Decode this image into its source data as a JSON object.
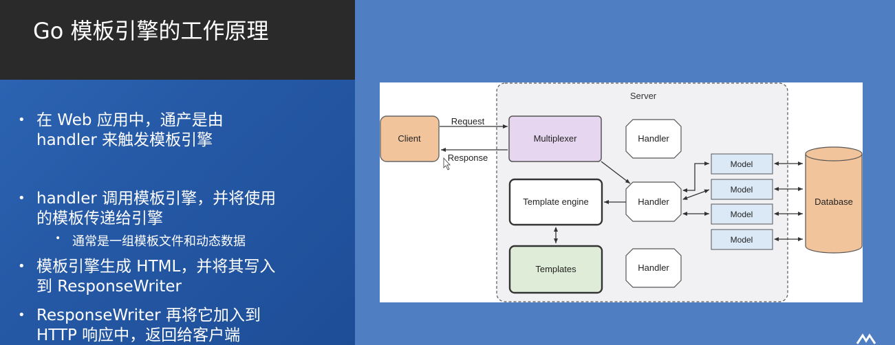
{
  "slide": {
    "title": "Go 模板引擎的工作原理",
    "bullets": [
      {
        "lines": [
          "在 Web 应用中，通产是由",
          "handler 来触发模板引擎"
        ]
      },
      {
        "lines": [
          "handler 调用模板引擎，并将使用",
          "的模板传递给引擎"
        ],
        "sub": [
          "通常是一组模板文件和动态数据"
        ]
      },
      {
        "lines": [
          "模板引擎生成 HTML，并将其写入",
          "到 ResponseWriter"
        ]
      },
      {
        "lines": [
          "ResponseWriter 再将它加入到",
          "HTTP 响应中，返回给客户端"
        ]
      }
    ]
  },
  "diagram": {
    "server_label": "Server",
    "client": "Client",
    "multiplexer": "Multiplexer",
    "handler_top": "Handler",
    "handler_mid": "Handler",
    "handler_bottom": "Handler",
    "template_engine": "Template engine",
    "templates": "Templates",
    "models": [
      "Model",
      "Model",
      "Model",
      "Model"
    ],
    "database": "Database",
    "request": "Request",
    "response": "Response"
  },
  "colors": {
    "slide_bg": "#4f7ec2",
    "title_bar": "#2a2a2a",
    "client_fill": "#f2c49b",
    "multiplexer_fill": "#e6d6ef",
    "templates_fill": "#dfecd8",
    "model_fill": "#dbe9f7",
    "database_fill": "#f2c49b",
    "server_fill": "#f1f0f3"
  },
  "icons": [
    "mouse-cursor-icon",
    "slide-corner-icon"
  ]
}
